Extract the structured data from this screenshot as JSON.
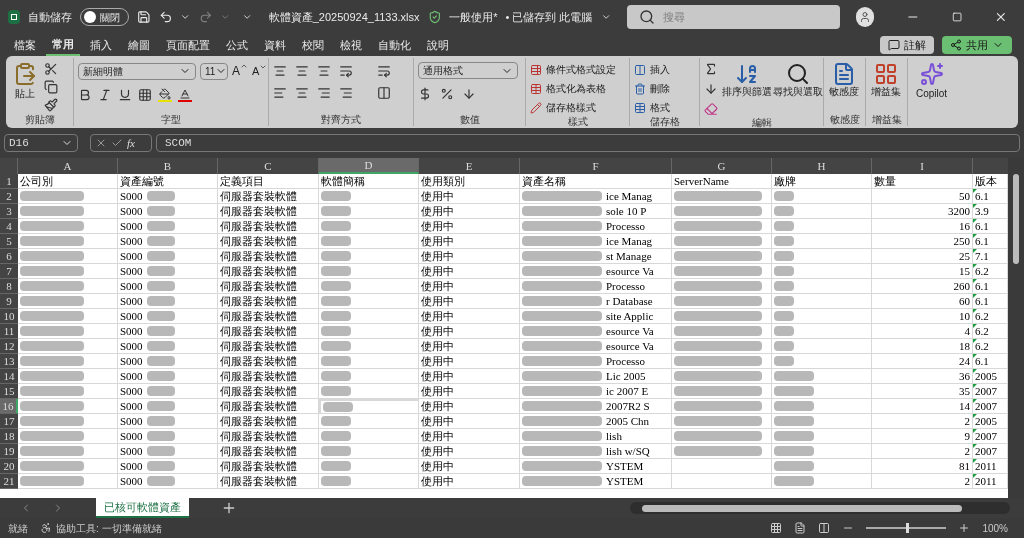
{
  "title_bar": {
    "autosave_label": "自動儲存",
    "autosave": {
      "label": "關閉",
      "on": false
    },
    "filename": "軟體資產_20250924_1133.xlsx",
    "sensitivity": "一般使用*",
    "save_status": "• 已儲存到 此電腦",
    "search": {
      "placeholder": "搜尋"
    }
  },
  "menu_tabs": [
    {
      "label": "檔案",
      "selected": false
    },
    {
      "label": "常用",
      "selected": true
    },
    {
      "label": "插入",
      "selected": false
    },
    {
      "label": "繪圖",
      "selected": false
    },
    {
      "label": "頁面配置",
      "selected": false
    },
    {
      "label": "公式",
      "selected": false
    },
    {
      "label": "資料",
      "selected": false
    },
    {
      "label": "校閱",
      "selected": false
    },
    {
      "label": "檢視",
      "selected": false
    },
    {
      "label": "自動化",
      "selected": false
    },
    {
      "label": "說明",
      "selected": false
    }
  ],
  "comments_button": "註解",
  "share_button": "共用",
  "ribbon": {
    "clipboard": {
      "paste": "貼上",
      "label": "剪貼簿"
    },
    "font": {
      "family": "新細明體",
      "size": "11",
      "grow": "A",
      "shrink": "A",
      "label": "字型"
    },
    "alignment": {
      "label": "對齊方式"
    },
    "number": {
      "format": "通用格式",
      "label": "數值"
    },
    "styles": {
      "items": [
        "條件式格式設定",
        "格式化為表格",
        "儲存格樣式"
      ],
      "label": "樣式"
    },
    "cells": {
      "items": [
        "插入",
        "刪除",
        "格式"
      ],
      "label": "儲存格"
    },
    "editing": {
      "sort": "排序與篩選",
      "find": "尋找與選取",
      "label": "編輯"
    },
    "sensitivity": {
      "button": "敏感度",
      "label": "敏感度"
    },
    "addins": {
      "button": "增益集",
      "label": "增益集"
    },
    "copilot": {
      "button": "Copilot"
    }
  },
  "formula_bar": {
    "name_box": "D16",
    "fx_label": "fx",
    "value": "SCOM"
  },
  "columns": [
    {
      "label": "A",
      "selected": false
    },
    {
      "label": "B",
      "selected": false
    },
    {
      "label": "C",
      "selected": false
    },
    {
      "label": "D",
      "selected": true
    },
    {
      "label": "E",
      "selected": false
    },
    {
      "label": "F",
      "selected": false
    },
    {
      "label": "G",
      "selected": false
    },
    {
      "label": "H",
      "selected": false
    },
    {
      "label": "I",
      "selected": false
    }
  ],
  "header_row": {
    "number": "1",
    "cells": [
      "公司別",
      "資產編號",
      "定義項目",
      "軟體簡稱",
      "使用類別",
      "資產名稱",
      "ServerName",
      "廠牌",
      "數量",
      "版本"
    ]
  },
  "rows": [
    {
      "number": "2",
      "selected": false,
      "asset_prefix": "S000",
      "category": "伺服器套裝軟體",
      "usage": "使用中",
      "fragment": "ice Manag",
      "server": true,
      "quantity": "50",
      "version": "6.1"
    },
    {
      "number": "3",
      "selected": false,
      "asset_prefix": "S000",
      "category": "伺服器套裝軟體",
      "usage": "使用中",
      "fragment": "sole 10 P",
      "server": true,
      "quantity": "3200",
      "version": "3.9"
    },
    {
      "number": "4",
      "selected": false,
      "asset_prefix": "S000",
      "category": "伺服器套裝軟體",
      "usage": "使用中",
      "fragment": "Processo",
      "server": true,
      "quantity": "16",
      "version": "6.1"
    },
    {
      "number": "5",
      "selected": false,
      "asset_prefix": "S000",
      "category": "伺服器套裝軟體",
      "usage": "使用中",
      "fragment": "ice Manag",
      "server": true,
      "quantity": "250",
      "version": "6.1"
    },
    {
      "number": "6",
      "selected": false,
      "asset_prefix": "S000",
      "category": "伺服器套裝軟體",
      "usage": "使用中",
      "fragment": "st Manage",
      "server": true,
      "quantity": "25",
      "version": "7.1"
    },
    {
      "number": "7",
      "selected": false,
      "asset_prefix": "S000",
      "category": "伺服器套裝軟體",
      "usage": "使用中",
      "fragment": "esource Va",
      "server": true,
      "quantity": "15",
      "version": "6.2"
    },
    {
      "number": "8",
      "selected": false,
      "asset_prefix": "S000",
      "category": "伺服器套裝軟體",
      "usage": "使用中",
      "fragment": "Processo",
      "server": true,
      "quantity": "260",
      "version": "6.1"
    },
    {
      "number": "9",
      "selected": false,
      "asset_prefix": "S000",
      "category": "伺服器套裝軟體",
      "usage": "使用中",
      "fragment": "r Database",
      "server": true,
      "quantity": "60",
      "version": "6.1"
    },
    {
      "number": "10",
      "selected": false,
      "asset_prefix": "S000",
      "category": "伺服器套裝軟體",
      "usage": "使用中",
      "fragment": "site Applic",
      "server": true,
      "quantity": "10",
      "version": "6.2"
    },
    {
      "number": "11",
      "selected": false,
      "asset_prefix": "S000",
      "category": "伺服器套裝軟體",
      "usage": "使用中",
      "fragment": "esource Va",
      "server": true,
      "quantity": "4",
      "version": "6.2"
    },
    {
      "number": "12",
      "selected": false,
      "asset_prefix": "S000",
      "category": "伺服器套裝軟體",
      "usage": "使用中",
      "fragment": "esource Va",
      "server": true,
      "quantity": "18",
      "version": "6.2"
    },
    {
      "number": "13",
      "selected": false,
      "asset_prefix": "S000",
      "category": "伺服器套裝軟體",
      "usage": "使用中",
      "fragment": "Processo",
      "server": true,
      "quantity": "24",
      "version": "6.1"
    },
    {
      "number": "14",
      "selected": false,
      "asset_prefix": "S000",
      "category": "伺服器套裝軟體",
      "usage": "使用中",
      "fragment": "Lic 2005",
      "server": true,
      "quantity": "36",
      "version": "2005"
    },
    {
      "number": "15",
      "selected": false,
      "asset_prefix": "S000",
      "category": "伺服器套裝軟體",
      "usage": "使用中",
      "fragment": "ic 2007 E",
      "server": true,
      "quantity": "35",
      "version": "2007"
    },
    {
      "number": "16",
      "selected": true,
      "asset_prefix": "S000",
      "category": "伺服器套裝軟體",
      "usage": "使用中",
      "fragment": "2007R2 S",
      "server": true,
      "quantity": "14",
      "version": "2007"
    },
    {
      "number": "17",
      "selected": false,
      "asset_prefix": "S000",
      "category": "伺服器套裝軟體",
      "usage": "使用中",
      "fragment": "2005 Chn",
      "server": true,
      "quantity": "2",
      "version": "2005"
    },
    {
      "number": "18",
      "selected": false,
      "asset_prefix": "S000",
      "category": "伺服器套裝軟體",
      "usage": "使用中",
      "fragment": "lish",
      "server": true,
      "quantity": "9",
      "version": "2007"
    },
    {
      "number": "19",
      "selected": false,
      "asset_prefix": "S000",
      "category": "伺服器套裝軟體",
      "usage": "使用中",
      "fragment": "lish w/SQ",
      "server": true,
      "quantity": "2",
      "version": "2007"
    },
    {
      "number": "20",
      "selected": false,
      "asset_prefix": "S000",
      "category": "伺服器套裝軟體",
      "usage": "使用中",
      "fragment": "YSTEM",
      "server": false,
      "quantity": "81",
      "version": "2011"
    },
    {
      "number": "21",
      "selected": false,
      "asset_prefix": "S000",
      "category": "伺服器套裝軟體",
      "usage": "使用中",
      "fragment": "YSTEM",
      "server": false,
      "quantity": "2",
      "version": "2011"
    }
  ],
  "sheet_tabs": [
    {
      "label": "已核可軟體資產",
      "selected": true
    }
  ],
  "status_bar": {
    "ready": "就緒",
    "accessibility": "協助工具: 一切準備就緒",
    "zoom": "100%",
    "zoom_slider": {
      "level": 0.5
    }
  }
}
